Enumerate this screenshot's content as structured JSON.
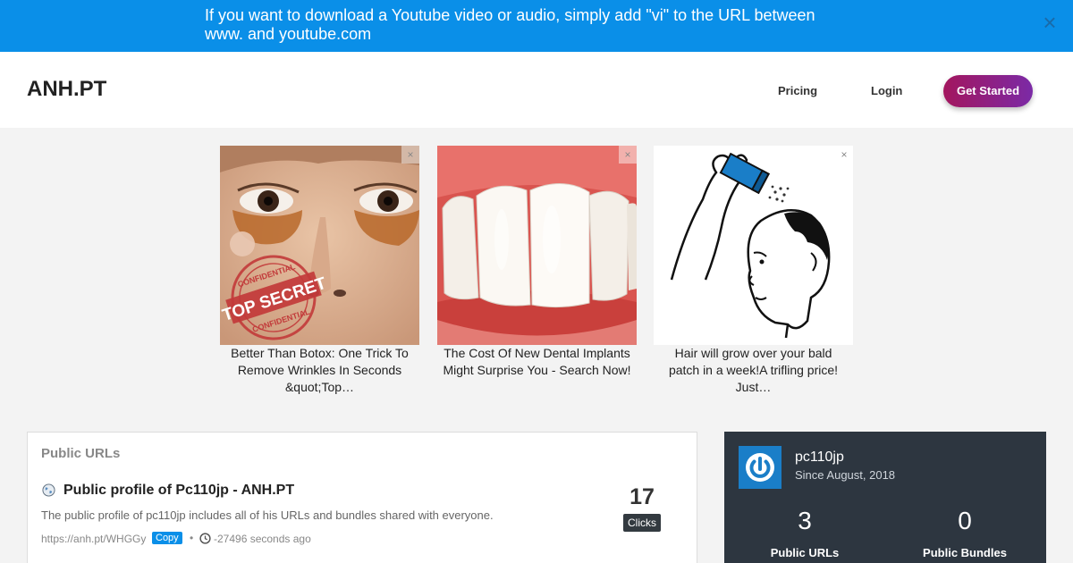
{
  "banner": {
    "text": "If you want to download a Youtube video or audio, simply add \"vi\" to the URL between www. and youtube.com",
    "close_icon": "close-icon",
    "color": "#0a8fe8"
  },
  "header": {
    "logo": "ANH.PT",
    "nav": {
      "pricing": "Pricing",
      "login": "Login",
      "get_started": "Get Started"
    }
  },
  "ads": [
    {
      "caption": "Better Than Botox: One Trick To Remove Wrinkles In Seconds &quot;Top…",
      "stamp_line1": "TOP SECRET",
      "stamp_line2": "CONFIDENTIAL",
      "close": "×"
    },
    {
      "caption": "The Cost Of New Dental Implants Might Surprise You - Search Now!",
      "close": "×"
    },
    {
      "caption": "Hair will grow over your bald patch in a week!A trifling price! Just…",
      "close": "×"
    }
  ],
  "public_urls": {
    "title": "Public URLs",
    "items": [
      {
        "title": "Public profile of Pc110jp - ANH.PT",
        "description": "The public profile of pc110jp includes all of his URLs and bundles shared with everyone.",
        "short_url": "https://anh.pt/WHGGy",
        "copy_label": "Copy",
        "separator": "•",
        "time": "-27496 seconds ago",
        "clicks": "17",
        "clicks_label": "Clicks"
      }
    ]
  },
  "profile": {
    "username": "pc110jp",
    "since": "Since August, 2018",
    "stats": [
      {
        "value": "3",
        "label": "Public URLs"
      },
      {
        "value": "0",
        "label": "Public Bundles"
      }
    ]
  }
}
